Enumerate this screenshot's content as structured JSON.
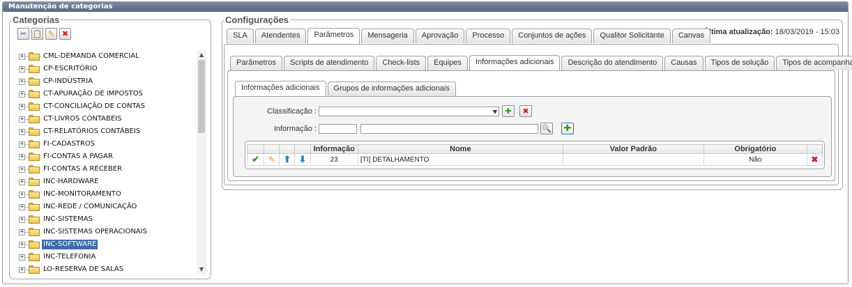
{
  "window": {
    "title": "Manutenção de categorias"
  },
  "left": {
    "legend": "Categorias",
    "toolbar": {
      "cut_icon": "scissors-icon",
      "paste_icon": "clipboard-icon",
      "edit_icon": "pencil-icon",
      "delete_icon": "delete-x-icon"
    },
    "tree": [
      {
        "label": "CML-DEMANDA COMERCIAL"
      },
      {
        "label": "CP-ESCRITÓRIO"
      },
      {
        "label": "CP-INDÚSTRIA"
      },
      {
        "label": "CT-APURAÇÃO DE IMPOSTOS"
      },
      {
        "label": "CT-CONCILIAÇÃO DE CONTAS"
      },
      {
        "label": "CT-LIVROS CONTABEIS"
      },
      {
        "label": "CT-RELATÓRIOS CONTÁBEIS"
      },
      {
        "label": "FI-CADASTROS"
      },
      {
        "label": "FI-CONTAS A PAGAR"
      },
      {
        "label": "FI-CONTAS A RECEBER"
      },
      {
        "label": "INC-HARDWARE"
      },
      {
        "label": "INC-MONITORAMENTO"
      },
      {
        "label": "INC-REDE / COMUNICAÇÃO"
      },
      {
        "label": "INC-SISTEMAS"
      },
      {
        "label": "INC-SISTEMAS OPERACIONAIS"
      },
      {
        "label": "INC-SOFTWARE",
        "selected": true
      },
      {
        "label": "INC-TELEFONIA"
      },
      {
        "label": "LO-RESERVA DE SALAS"
      }
    ]
  },
  "right": {
    "legend": "Configurações",
    "last_update_label": "Última atualização:",
    "last_update_value": "18/03/2019 - 15:03",
    "main_tabs": [
      {
        "label": "SLA"
      },
      {
        "label": "Atendentes"
      },
      {
        "label": "Parâmetros",
        "active": true
      },
      {
        "label": "Mensageria"
      },
      {
        "label": "Aprovação"
      },
      {
        "label": "Processo"
      },
      {
        "label": "Conjuntos de ações"
      },
      {
        "label": "Qualitor Solicitante"
      },
      {
        "label": "Canvas"
      }
    ],
    "sub_tabs": [
      {
        "label": "Parâmetros"
      },
      {
        "label": "Scripts de atendimento"
      },
      {
        "label": "Check-lists"
      },
      {
        "label": "Equipes"
      },
      {
        "label": "Informações adicionais",
        "active": true
      },
      {
        "label": "Descrição do atendimento"
      },
      {
        "label": "Causas"
      },
      {
        "label": "Tipos de solução"
      },
      {
        "label": "Tipos de acompanhamento"
      }
    ],
    "inner_tabs": [
      {
        "label": "Informações adicionais",
        "active": true
      },
      {
        "label": "Grupos de informações adicionais"
      }
    ],
    "form": {
      "classificacao_label": "Classificação :",
      "classificacao_value": "",
      "informacao_label": "Informação :",
      "informacao_code": "",
      "informacao_name": ""
    },
    "grid": {
      "columns": [
        "Informação",
        "Nome",
        "Valor Padrão",
        "Obrigatório"
      ],
      "rows": [
        {
          "informacao": "23",
          "nome": "[TI] DETALHAMENTO",
          "valor_padrao": "",
          "obrigatorio": "Não"
        }
      ]
    },
    "colors": {
      "titlebar": "#5a6882",
      "selected": "#3e6ca8",
      "check": "#2e9a1e",
      "arrow": "#2a7fd4",
      "delete": "#d42020"
    }
  }
}
